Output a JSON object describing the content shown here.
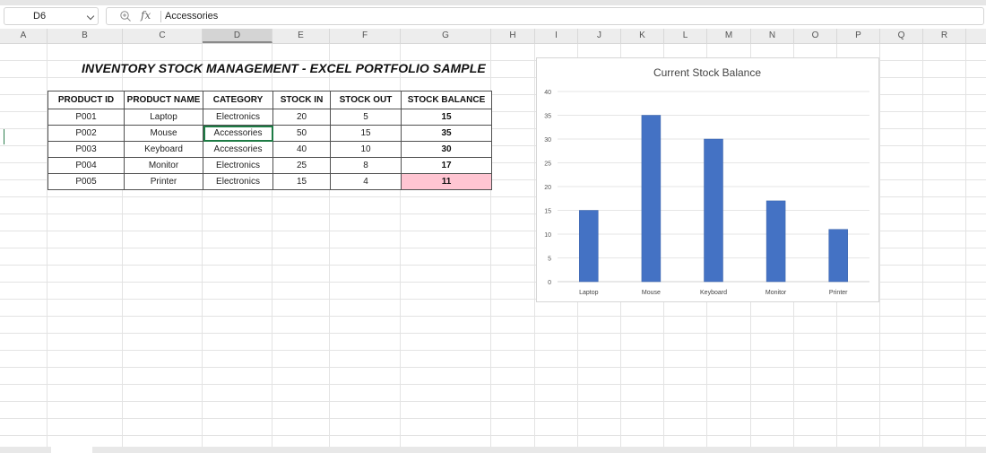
{
  "formula_bar": {
    "name_box": "D6",
    "fx_label": "fx",
    "formula_value": "Accessories"
  },
  "columns": [
    "A",
    "B",
    "C",
    "D",
    "E",
    "F",
    "G",
    "H",
    "I",
    "J",
    "K",
    "L",
    "M",
    "N",
    "O",
    "P",
    "Q",
    "R"
  ],
  "selected_column": "D",
  "sheet": {
    "title": "INVENTORY STOCK MANAGEMENT - EXCEL PORTFOLIO SAMPLE",
    "table": {
      "headers": [
        "PRODUCT ID",
        "PRODUCT NAME",
        "CATEGORY",
        "STOCK IN",
        "STOCK OUT",
        "STOCK BALANCE"
      ],
      "rows": [
        [
          "P001",
          "Laptop",
          "Electronics",
          "20",
          "5",
          "15"
        ],
        [
          "P002",
          "Mouse",
          "Accessories",
          "50",
          "15",
          "35"
        ],
        [
          "P003",
          "Keyboard",
          "Accessories",
          "40",
          "10",
          "30"
        ],
        [
          "P004",
          "Monitor",
          "Electronics",
          "25",
          "8",
          "17"
        ],
        [
          "P005",
          "Printer",
          "Electronics",
          "15",
          "4",
          "11"
        ]
      ],
      "selected_cell": "Accessories",
      "highlight_color": "#ffc5d2"
    }
  },
  "chart_data": {
    "type": "bar",
    "title": "Current Stock  Balance",
    "categories": [
      "Laptop",
      "Mouse",
      "Keyboard",
      "Monitor",
      "Printer"
    ],
    "values": [
      15,
      35,
      30,
      17,
      11
    ],
    "ylim": [
      0,
      40
    ],
    "yticks": [
      "0",
      "5",
      "10",
      "15",
      "20",
      "25",
      "30",
      "35",
      "40"
    ],
    "grid": true,
    "legend": "none",
    "bar_color": "#4472c4"
  }
}
